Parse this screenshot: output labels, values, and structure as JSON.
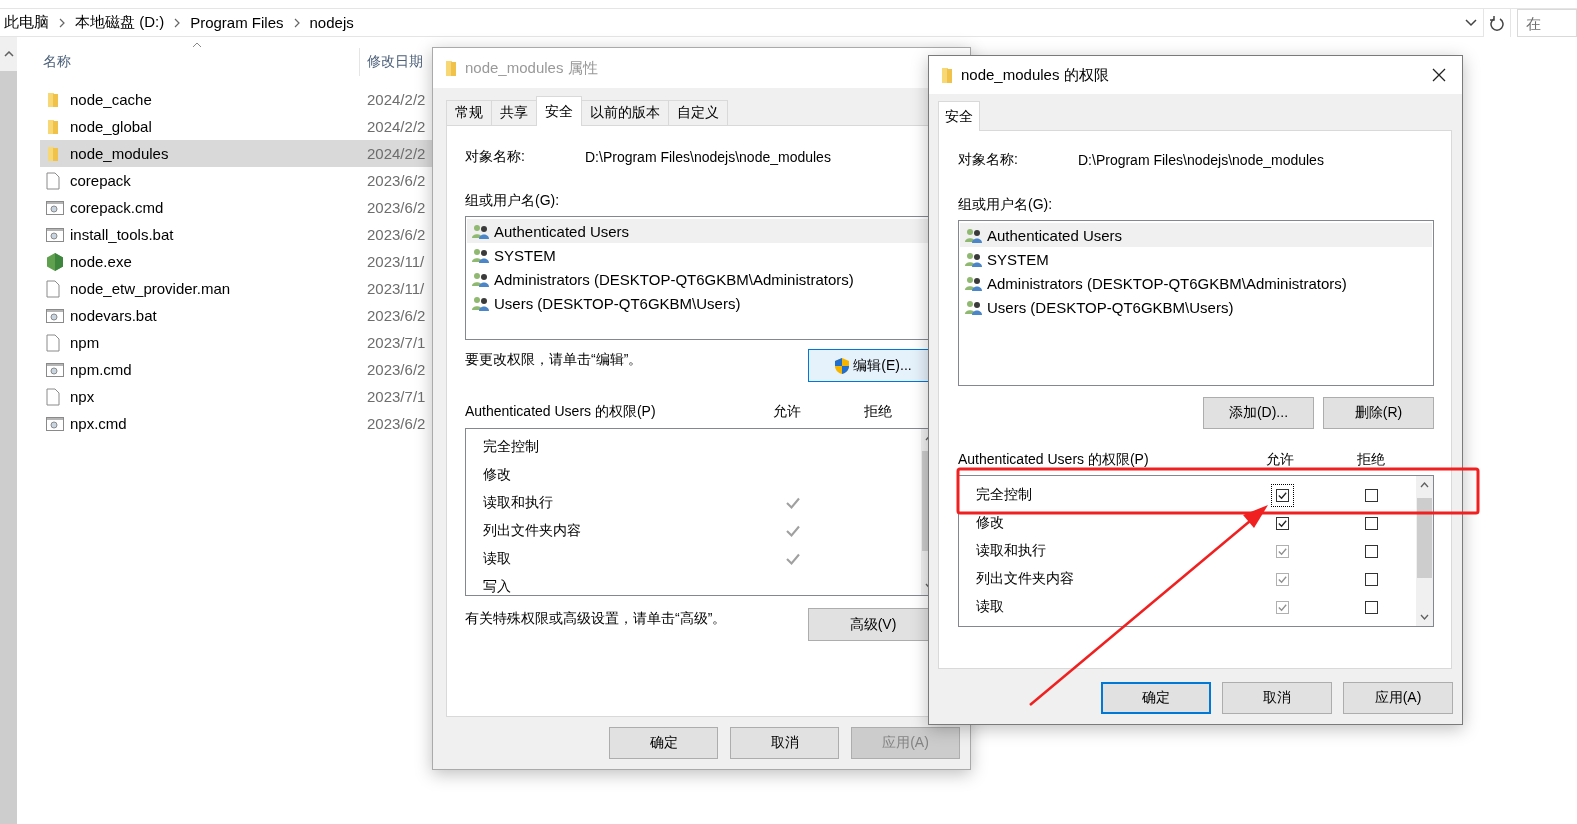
{
  "explorer": {
    "breadcrumb": [
      "此电脑",
      "本地磁盘 (D:)",
      "Program Files",
      "nodejs"
    ],
    "search": {
      "placeholder": "在"
    },
    "columns": [
      "名称",
      "修改日期"
    ],
    "files": [
      {
        "name": "node_cache",
        "date": "2024/2/2",
        "kind": "folder",
        "selected": false
      },
      {
        "name": "node_global",
        "date": "2024/2/2",
        "kind": "folder",
        "selected": false
      },
      {
        "name": "node_modules",
        "date": "2024/2/2",
        "kind": "folder",
        "selected": true
      },
      {
        "name": "corepack",
        "date": "2023/6/2",
        "kind": "file",
        "selected": false
      },
      {
        "name": "corepack.cmd",
        "date": "2023/6/2",
        "kind": "script",
        "selected": false
      },
      {
        "name": "install_tools.bat",
        "date": "2023/6/2",
        "kind": "script",
        "selected": false
      },
      {
        "name": "node.exe",
        "date": "2023/11/",
        "kind": "node",
        "selected": false
      },
      {
        "name": "node_etw_provider.man",
        "date": "2023/11/",
        "kind": "file",
        "selected": false
      },
      {
        "name": "nodevars.bat",
        "date": "2023/6/2",
        "kind": "script",
        "selected": false
      },
      {
        "name": "npm",
        "date": "2023/7/1",
        "kind": "file",
        "selected": false
      },
      {
        "name": "npm.cmd",
        "date": "2023/6/2",
        "kind": "script",
        "selected": false
      },
      {
        "name": "npx",
        "date": "2023/7/1",
        "kind": "file",
        "selected": false
      },
      {
        "name": "npx.cmd",
        "date": "2023/6/2",
        "kind": "script",
        "selected": false
      }
    ]
  },
  "properties_dialog": {
    "title": "node_modules 属性",
    "active": false,
    "tabs": [
      {
        "label": "常规",
        "selected": false
      },
      {
        "label": "共享",
        "selected": false
      },
      {
        "label": "安全",
        "selected": true
      },
      {
        "label": "以前的版本",
        "selected": false
      },
      {
        "label": "自定义",
        "selected": false
      }
    ],
    "object_label": "对象名称:",
    "object_path": "D:\\Program Files\\nodejs\\node_modules",
    "group_label": "组或用户名(G):",
    "users": [
      {
        "name": "Authenticated Users",
        "selected": true
      },
      {
        "name": "SYSTEM",
        "selected": false
      },
      {
        "name": "Administrators (DESKTOP-QT6GKBM\\Administrators)",
        "selected": false
      },
      {
        "name": "Users (DESKTOP-QT6GKBM\\Users)",
        "selected": false
      }
    ],
    "edit_hint": "要更改权限，请单击“编辑”。",
    "edit_button": "编辑(E)...",
    "permissions_label": "Authenticated Users 的权限(P)",
    "allow_label": "允许",
    "deny_label": "拒绝",
    "permissions": [
      {
        "name": "完全控制",
        "allow_checked": false
      },
      {
        "name": "修改",
        "allow_checked": false
      },
      {
        "name": "读取和执行",
        "allow_checked": true
      },
      {
        "name": "列出文件夹内容",
        "allow_checked": true
      },
      {
        "name": "读取",
        "allow_checked": true
      },
      {
        "name": "写入",
        "allow_checked": false
      }
    ],
    "advanced_hint": "有关特殊权限或高级设置，请单击“高级”。",
    "advanced_button": "高级(V)",
    "buttons": [
      {
        "label": "确定",
        "disabled": false,
        "default": false
      },
      {
        "label": "取消",
        "disabled": false,
        "default": false
      },
      {
        "label": "应用(A)",
        "disabled": true,
        "default": false
      }
    ]
  },
  "permissions_dialog": {
    "title": "node_modules 的权限",
    "active": true,
    "tabs": [
      {
        "label": "安全",
        "selected": true
      }
    ],
    "object_label": "对象名称:",
    "object_path": "D:\\Program Files\\nodejs\\node_modules",
    "group_label": "组或用户名(G):",
    "users": [
      {
        "name": "Authenticated Users",
        "selected": true
      },
      {
        "name": "SYSTEM",
        "selected": false
      },
      {
        "name": "Administrators (DESKTOP-QT6GKBM\\Administrators)",
        "selected": false
      },
      {
        "name": "Users (DESKTOP-QT6GKBM\\Users)",
        "selected": false
      }
    ],
    "list_buttons": [
      "添加(D)...",
      "删除(R)"
    ],
    "permissions_label": "Authenticated Users 的权限(P)",
    "allow_label": "允许",
    "deny_label": "拒绝",
    "permissions": [
      {
        "name": "完全控制",
        "allow_checked": true,
        "allow_disabled": false,
        "deny_checked": false,
        "focused": true
      },
      {
        "name": "修改",
        "allow_checked": true,
        "allow_disabled": false,
        "deny_checked": false,
        "focused": false
      },
      {
        "name": "读取和执行",
        "allow_checked": true,
        "allow_disabled": true,
        "deny_checked": false,
        "focused": false
      },
      {
        "name": "列出文件夹内容",
        "allow_checked": true,
        "allow_disabled": true,
        "deny_checked": false,
        "focused": false
      },
      {
        "name": "读取",
        "allow_checked": true,
        "allow_disabled": true,
        "deny_checked": false,
        "focused": false
      }
    ],
    "buttons": [
      {
        "label": "确定",
        "disabled": false,
        "default": true
      },
      {
        "label": "取消",
        "disabled": false,
        "default": false
      },
      {
        "label": "应用(A)",
        "disabled": false,
        "default": false
      }
    ]
  }
}
